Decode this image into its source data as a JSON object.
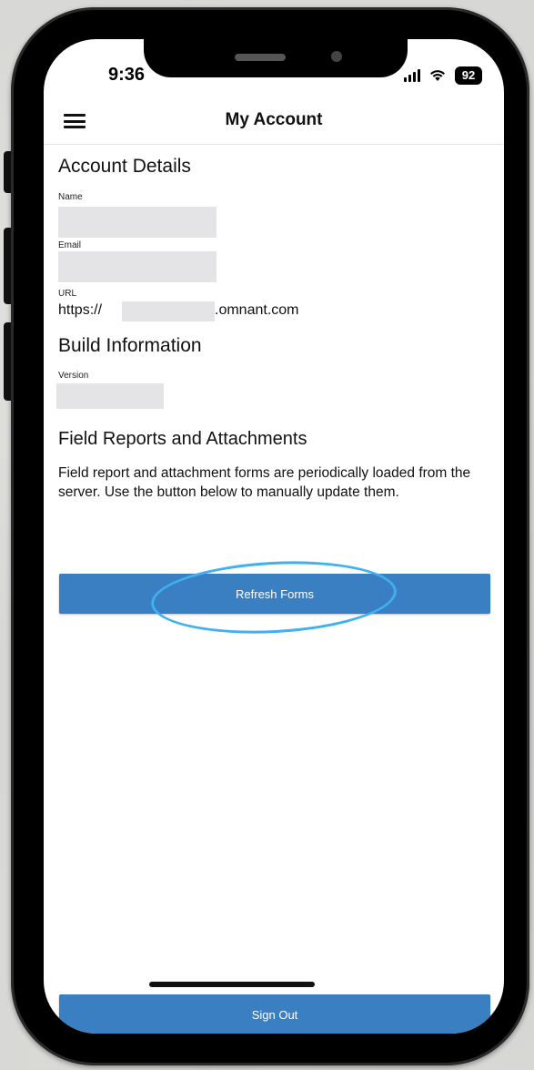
{
  "status_bar": {
    "time": "9:36",
    "battery": "92"
  },
  "nav": {
    "title": "My Account"
  },
  "account_details": {
    "heading": "Account Details",
    "name_label": "Name",
    "email_label": "Email",
    "url_label": "URL",
    "url_prefix": "https://",
    "url_suffix": ".omnant.com"
  },
  "build_info": {
    "heading": "Build Information",
    "version_label": "Version"
  },
  "field_reports": {
    "heading": "Field Reports and Attachments",
    "description": "Field report and attachment forms are periodically loaded from the server. Use the button below to manually update them.",
    "refresh_label": "Refresh Forms"
  },
  "sign_out_label": "Sign Out",
  "colors": {
    "button": "#3a7fc1",
    "highlight": "#3fb0f0"
  }
}
